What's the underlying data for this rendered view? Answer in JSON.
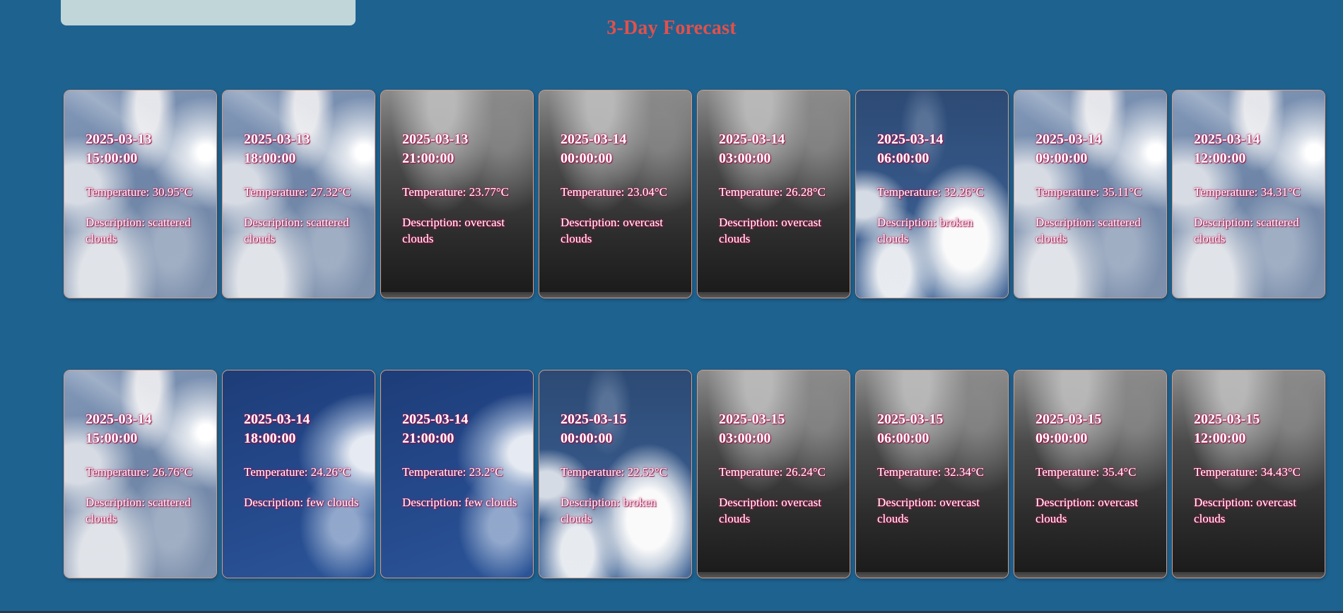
{
  "header": {
    "title": "3-Day Forecast"
  },
  "labels": {
    "temperature": "Temperature:",
    "description": "Description:"
  },
  "forecast": [
    {
      "date": "2025-03-13",
      "time": "15:00:00",
      "temperature": "30.95°C",
      "description": "scattered clouds",
      "condition": "scattered"
    },
    {
      "date": "2025-03-13",
      "time": "18:00:00",
      "temperature": "27.32°C",
      "description": "scattered clouds",
      "condition": "scattered"
    },
    {
      "date": "2025-03-13",
      "time": "21:00:00",
      "temperature": "23.77°C",
      "description": "overcast clouds",
      "condition": "overcast"
    },
    {
      "date": "2025-03-14",
      "time": "00:00:00",
      "temperature": "23.04°C",
      "description": "overcast clouds",
      "condition": "overcast"
    },
    {
      "date": "2025-03-14",
      "time": "03:00:00",
      "temperature": "26.28°C",
      "description": "overcast clouds",
      "condition": "overcast"
    },
    {
      "date": "2025-03-14",
      "time": "06:00:00",
      "temperature": "32.26°C",
      "description": "broken clouds",
      "condition": "broken"
    },
    {
      "date": "2025-03-14",
      "time": "09:00:00",
      "temperature": "35.11°C",
      "description": "scattered clouds",
      "condition": "scattered"
    },
    {
      "date": "2025-03-14",
      "time": "12:00:00",
      "temperature": "34.31°C",
      "description": "scattered clouds",
      "condition": "scattered"
    },
    {
      "date": "2025-03-14",
      "time": "15:00:00",
      "temperature": "26.76°C",
      "description": "scattered clouds",
      "condition": "scattered"
    },
    {
      "date": "2025-03-14",
      "time": "18:00:00",
      "temperature": "24.26°C",
      "description": "few clouds",
      "condition": "few"
    },
    {
      "date": "2025-03-14",
      "time": "21:00:00",
      "temperature": "23.2°C",
      "description": "few clouds",
      "condition": "few"
    },
    {
      "date": "2025-03-15",
      "time": "00:00:00",
      "temperature": "22.52°C",
      "description": "broken clouds",
      "condition": "broken"
    },
    {
      "date": "2025-03-15",
      "time": "03:00:00",
      "temperature": "26.24°C",
      "description": "overcast clouds",
      "condition": "overcast"
    },
    {
      "date": "2025-03-15",
      "time": "06:00:00",
      "temperature": "32.34°C",
      "description": "overcast clouds",
      "condition": "overcast"
    },
    {
      "date": "2025-03-15",
      "time": "09:00:00",
      "temperature": "35.4°C",
      "description": "overcast clouds",
      "condition": "overcast"
    },
    {
      "date": "2025-03-15",
      "time": "12:00:00",
      "temperature": "34.43°C",
      "description": "overcast clouds",
      "condition": "overcast"
    }
  ],
  "colors": {
    "page_background": "#1e6290",
    "title": "#e3504a",
    "search_panel": "#c0d6d8",
    "card_border": "#d79c86",
    "text_glow": "#c0185a"
  }
}
